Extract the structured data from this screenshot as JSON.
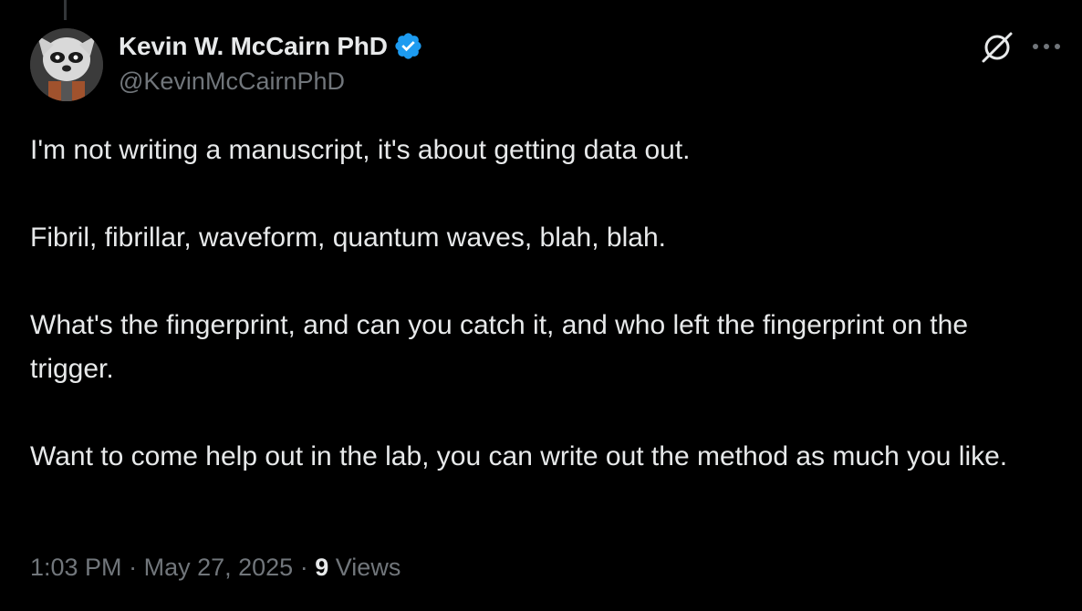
{
  "author": {
    "display_name": "Kevin W. McCairn PhD",
    "handle": "@KevinMcCairnPhD",
    "verified": true,
    "verified_color": "#1d9bf0"
  },
  "actions": {
    "grok_icon": "grok-icon",
    "more_icon": "more-horizontal-icon"
  },
  "tweet": {
    "paragraphs": [
      "I'm not writing a manuscript, it's about getting data out.",
      "Fibril, fibrillar, waveform, quantum waves, blah, blah.",
      "What's the fingerprint, and can you catch it, and who left the fingerprint on the trigger.",
      "Want to come help out in the lab, you can write out the method as much you like."
    ]
  },
  "meta": {
    "time": "1:03 PM",
    "separator": "·",
    "date": "May 27, 2025",
    "views_count": "9",
    "views_label": "Views"
  },
  "colors": {
    "background": "#000000",
    "text_primary": "#e7e9ea",
    "text_secondary": "#71767b"
  }
}
